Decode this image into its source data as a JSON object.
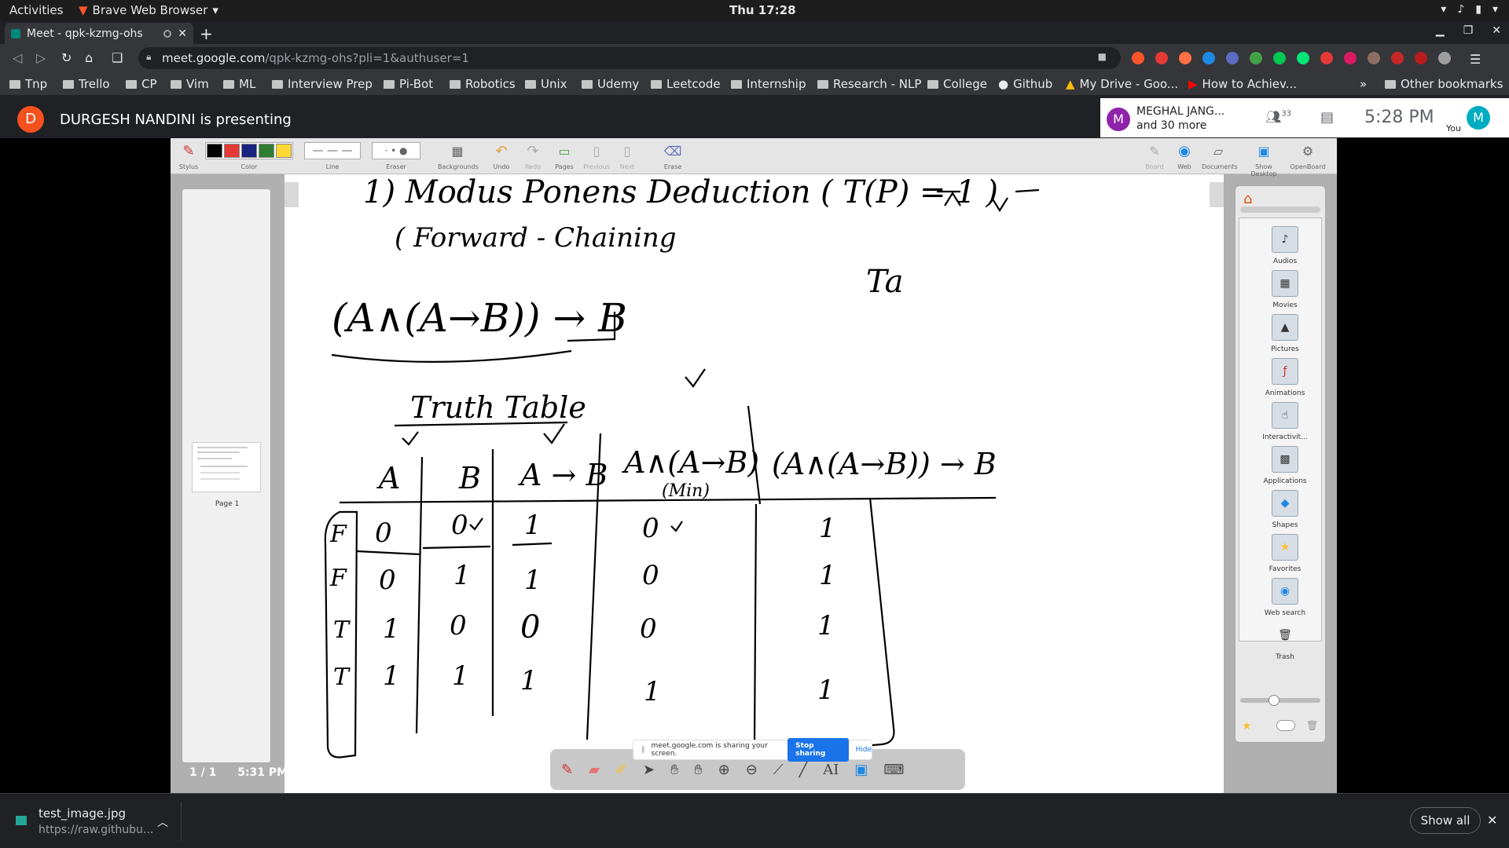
{
  "system": {
    "activities": "Activities",
    "app_name": "Brave Web Browser",
    "clock": "Thu 17:28"
  },
  "browser": {
    "tab_title": "Meet - qpk-kzmg-ohs",
    "url_host": "meet.google.com",
    "url_path": "/qpk-kzmg-ohs?pli=1&authuser=1",
    "bookmarks": [
      "Tnp",
      "Trello",
      "CP",
      "Vim",
      "ML",
      "Interview Prep",
      "Pi-Bot",
      "Robotics",
      "Unix",
      "Udemy",
      "Leetcode",
      "Internship",
      "Research - NLP",
      "College",
      "Github",
      "My Drive - Goo...",
      "How to Achiev..."
    ],
    "other_bookmarks": "Other bookmarks",
    "more_bookmarks": "»"
  },
  "meet": {
    "presenter_initial": "D",
    "presenter_text": "DURGESH NANDINI is presenting",
    "participant_initial": "M",
    "participant_name": "MEGHAL JANG...",
    "participant_more": "and 30 more",
    "people_count": "33",
    "time": "5:28 PM",
    "you_label": "You",
    "you_initial": "M"
  },
  "openboard": {
    "tools": [
      {
        "label": "Stylus"
      },
      {
        "label": "Color"
      },
      {
        "label": "Line"
      },
      {
        "label": "Eraser"
      },
      {
        "label": "Backgrounds"
      },
      {
        "label": "Undo"
      },
      {
        "label": "Redo"
      },
      {
        "label": "Pages"
      },
      {
        "label": "Previous"
      },
      {
        "label": "Next"
      },
      {
        "label": "Erase"
      }
    ],
    "right_tools": [
      {
        "label": "Board"
      },
      {
        "label": "Web"
      },
      {
        "label": "Documents"
      },
      {
        "label": "Show Desktop"
      },
      {
        "label": "OpenBoard"
      }
    ],
    "colors": [
      "#000000",
      "#e53935",
      "#1a237e",
      "#2e7d32",
      "#fdd835"
    ],
    "page_label": "Page 1",
    "page_status": "1 / 1",
    "page_time": "5:31 PM",
    "library": [
      "Audios",
      "Movies",
      "Pictures",
      "Animations",
      "Interactivit...",
      "Applications",
      "Shapes",
      "Favorites",
      "Web search",
      "Trash"
    ]
  },
  "whiteboard": {
    "heading": "1) Modus Ponens Deduction ( T(P) = 1 )",
    "subheading": "( Forward - Chaining",
    "formula": "(A∧(A→B)) → B",
    "side_note": "Ta",
    "truth_table_title": "Truth Table",
    "table_headers": [
      "A",
      "B",
      "A → B",
      "A∧(A→B)",
      "(A∧(A→B)) → B"
    ],
    "min_note": "(Min)",
    "row_labels": [
      "F",
      "F",
      "T",
      "T"
    ],
    "rows": [
      [
        "0",
        "0",
        "1",
        "0",
        "1"
      ],
      [
        "0",
        "1",
        "1",
        "0",
        "1"
      ],
      [
        "1",
        "0",
        "0",
        "0",
        "1"
      ],
      [
        "1",
        "1",
        "1",
        "1",
        "1"
      ]
    ]
  },
  "share_banner": {
    "text": "meet.google.com is sharing your screen.",
    "stop": "Stop sharing",
    "hide": "Hide"
  },
  "downloads": {
    "file": "test_image.jpg",
    "url": "https://raw.githubu...",
    "show_all": "Show all"
  }
}
